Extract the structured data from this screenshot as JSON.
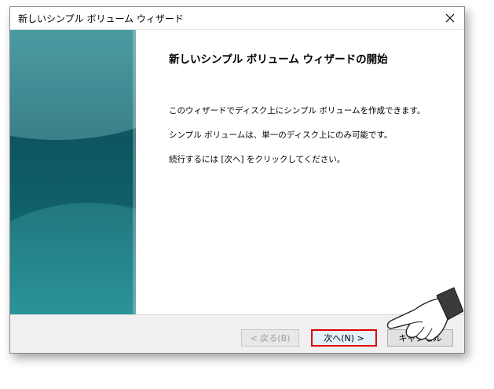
{
  "window": {
    "title": "新しいシンプル ボリューム ウィザード"
  },
  "content": {
    "heading": "新しいシンプル ボリューム ウィザードの開始",
    "paragraphs": [
      "このウィザードでディスク上にシンプル ボリュームを作成できます。",
      "シンプル ボリュームは、単一のディスク上にのみ可能です。",
      "続行するには [次へ] をクリックしてください。"
    ]
  },
  "buttons": {
    "back": "< 戻る(B)",
    "next": "次へ(N) >",
    "cancel": "キャンセル"
  },
  "icons": {
    "close": "close-icon",
    "pointer": "pointing-hand-icon"
  },
  "colors": {
    "highlight": "#e00000",
    "panel": "#0d5560"
  }
}
